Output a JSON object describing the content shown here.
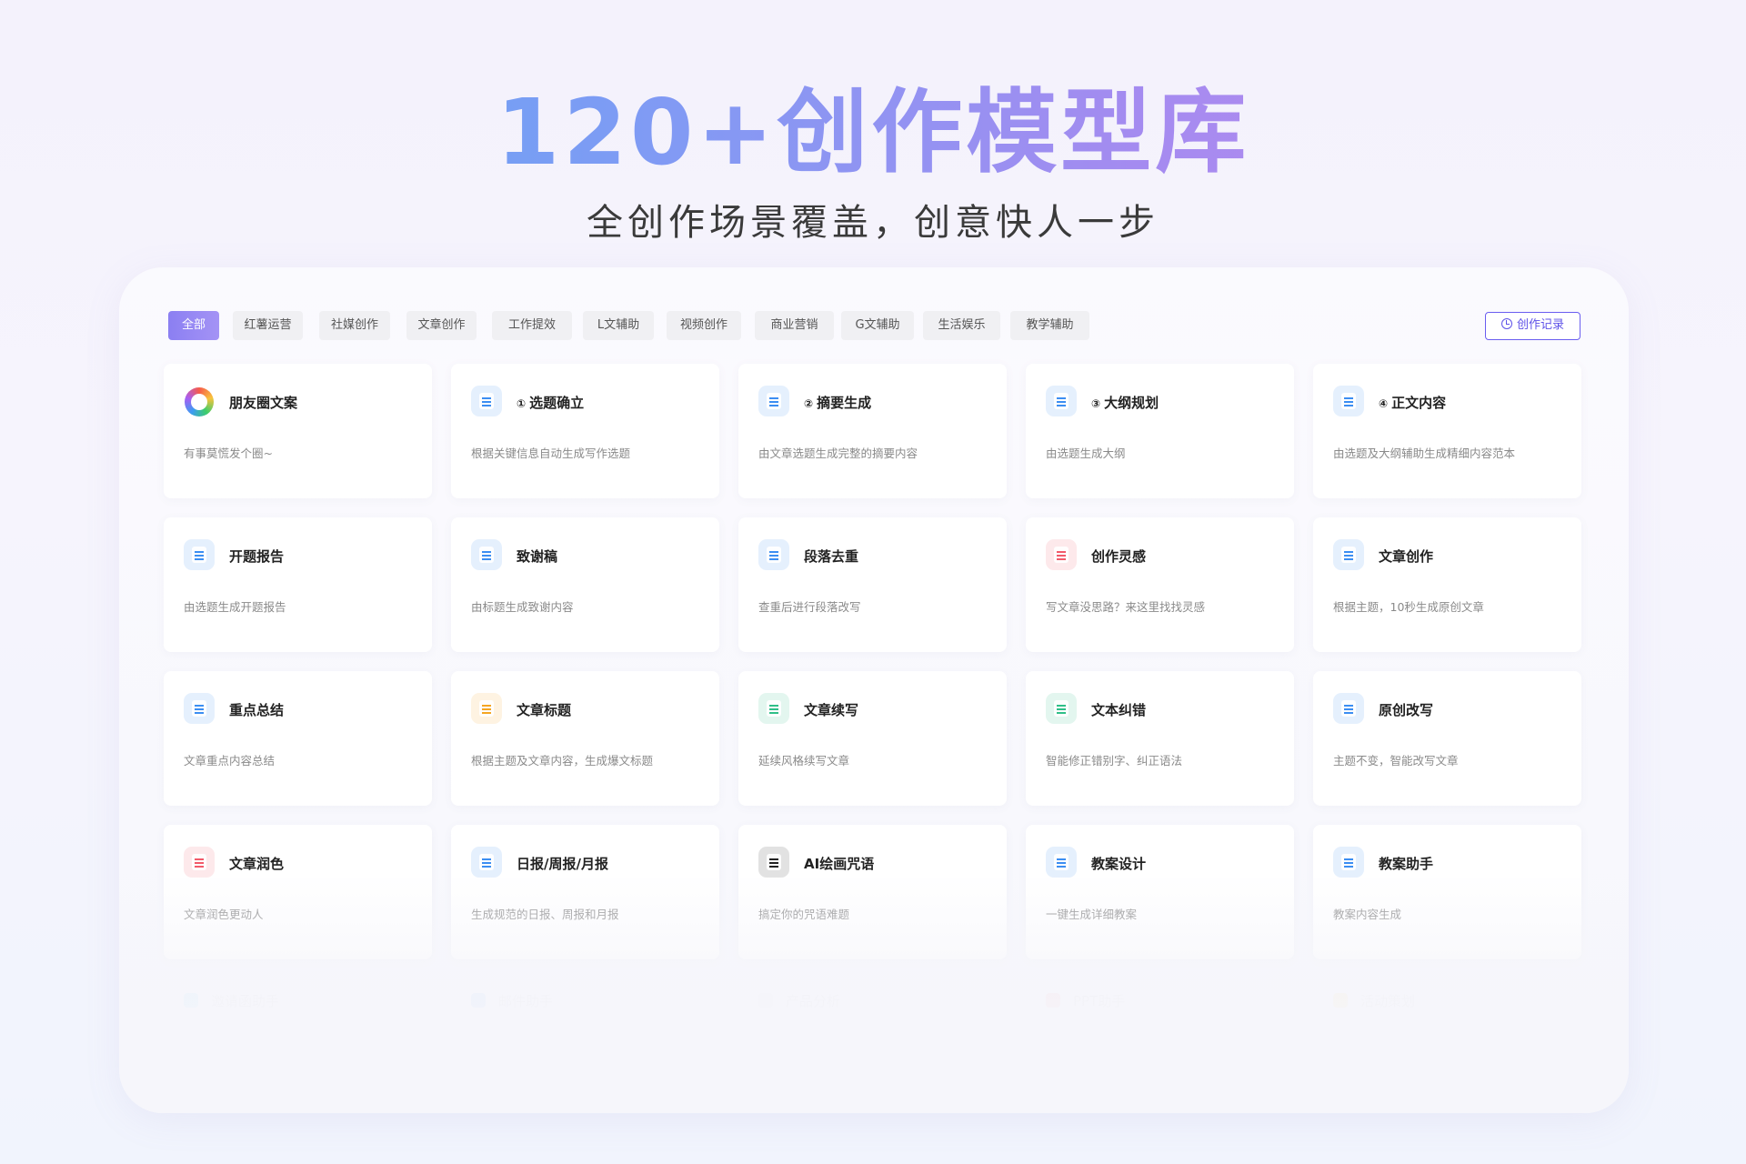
{
  "hero": {
    "title": "120+创作模型库",
    "subtitle": "全创作场景覆盖，创意快人一步"
  },
  "tabs": [
    {
      "label": "全部",
      "active": true
    },
    {
      "label": "红薯运营",
      "active": false
    },
    {
      "label": "社媒创作",
      "active": false
    },
    {
      "label": "文章创作",
      "active": false
    },
    {
      "label": "工作提效",
      "active": false
    },
    {
      "label": "L文辅助",
      "active": false
    },
    {
      "label": "视频创作",
      "active": false
    },
    {
      "label": "商业营销",
      "active": false
    },
    {
      "label": "G文辅助",
      "active": false
    },
    {
      "label": "生活娱乐",
      "active": false
    },
    {
      "label": "教学辅助",
      "active": false
    }
  ],
  "history_button": {
    "label": "创作记录",
    "icon": "clock-icon"
  },
  "cards": [
    {
      "title": "朋友圈文案",
      "step": "",
      "desc": "有事莫慌发个圈~",
      "icon": "moments-ring-icon",
      "color": "#f65b4a"
    },
    {
      "title": "选题确立",
      "step": "①",
      "desc": "根据关键信息自动生成写作选题",
      "icon": "topic-doc-icon",
      "color": "#3c8ef2"
    },
    {
      "title": "摘要生成",
      "step": "②",
      "desc": "由文章选题生成完整的摘要内容",
      "icon": "summary-doc-icon",
      "color": "#3c8ef2"
    },
    {
      "title": "大纲规划",
      "step": "③",
      "desc": "由选题生成大纲",
      "icon": "outline-doc-icon",
      "color": "#3c8ef2"
    },
    {
      "title": "正文内容",
      "step": "④",
      "desc": "由选题及大纲辅助生成精细内容范本",
      "icon": "content-doc-icon",
      "color": "#3c8ef2"
    },
    {
      "title": "开题报告",
      "step": "",
      "desc": "由选题生成开题报告",
      "icon": "report-icon",
      "color": "#3c8ef2"
    },
    {
      "title": "致谢稿",
      "step": "",
      "desc": "由标题生成致谢内容",
      "icon": "thanks-chat-icon",
      "color": "#3c8ef2"
    },
    {
      "title": "段落去重",
      "step": "",
      "desc": "查重后进行段落改写",
      "icon": "paragraph-icon",
      "color": "#3c8ef2"
    },
    {
      "title": "创作灵感",
      "step": "",
      "desc": "写文章没思路？来这里找找灵感",
      "icon": "inspiration-icon",
      "color": "#f25a6a"
    },
    {
      "title": "文章创作",
      "step": "",
      "desc": "根据主题，10秒生成原创文章",
      "icon": "article-icon",
      "color": "#3c8ef2"
    },
    {
      "title": "重点总结",
      "step": "",
      "desc": "文章重点内容总结",
      "icon": "key-summary-icon",
      "color": "#3c8ef2"
    },
    {
      "title": "文章标题",
      "step": "",
      "desc": "根据主题及文章内容，生成爆文标题",
      "icon": "headline-icon",
      "color": "#f5a623"
    },
    {
      "title": "文章续写",
      "step": "",
      "desc": "延续风格续写文章",
      "icon": "continue-icon",
      "color": "#2fbf88"
    },
    {
      "title": "文本纠错",
      "step": "",
      "desc": "智能修正错别字、纠正语法",
      "icon": "proofread-icon",
      "color": "#2fbf88"
    },
    {
      "title": "原创改写",
      "step": "",
      "desc": "主题不变，智能改写文章",
      "icon": "rewrite-icon",
      "color": "#3c8ef2"
    },
    {
      "title": "文章润色",
      "step": "",
      "desc": "文章润色更动人",
      "icon": "polish-icon",
      "color": "#f25a6a"
    },
    {
      "title": "日报/周报/月报",
      "step": "",
      "desc": "生成规范的日报、周报和月报",
      "icon": "daily-report-icon",
      "color": "#3c8ef2"
    },
    {
      "title": "AI绘画咒语",
      "step": "",
      "desc": "搞定你的咒语难题",
      "icon": "sailboat-icon",
      "color": "#222222"
    },
    {
      "title": "教案设计",
      "step": "",
      "desc": "一键生成详细教案",
      "icon": "lesson-design-icon",
      "color": "#3c8ef2"
    },
    {
      "title": "教案助手",
      "step": "",
      "desc": "教案内容生成",
      "icon": "lesson-helper-icon",
      "color": "#3c8ef2"
    }
  ],
  "faded_items": [
    {
      "label": "邀请函助手",
      "icon": "invitation-icon",
      "color": "#3cc6f2"
    },
    {
      "label": "邮件助手",
      "icon": "email-icon",
      "color": "#3c8ef2"
    },
    {
      "label": "产品分析",
      "icon": "product-icon",
      "color": "#cccccc"
    },
    {
      "label": "PPT助手",
      "icon": "ppt-icon",
      "color": "#f25a6a"
    },
    {
      "label": "活动策划",
      "icon": "event-icon",
      "color": "#f5c623"
    }
  ]
}
